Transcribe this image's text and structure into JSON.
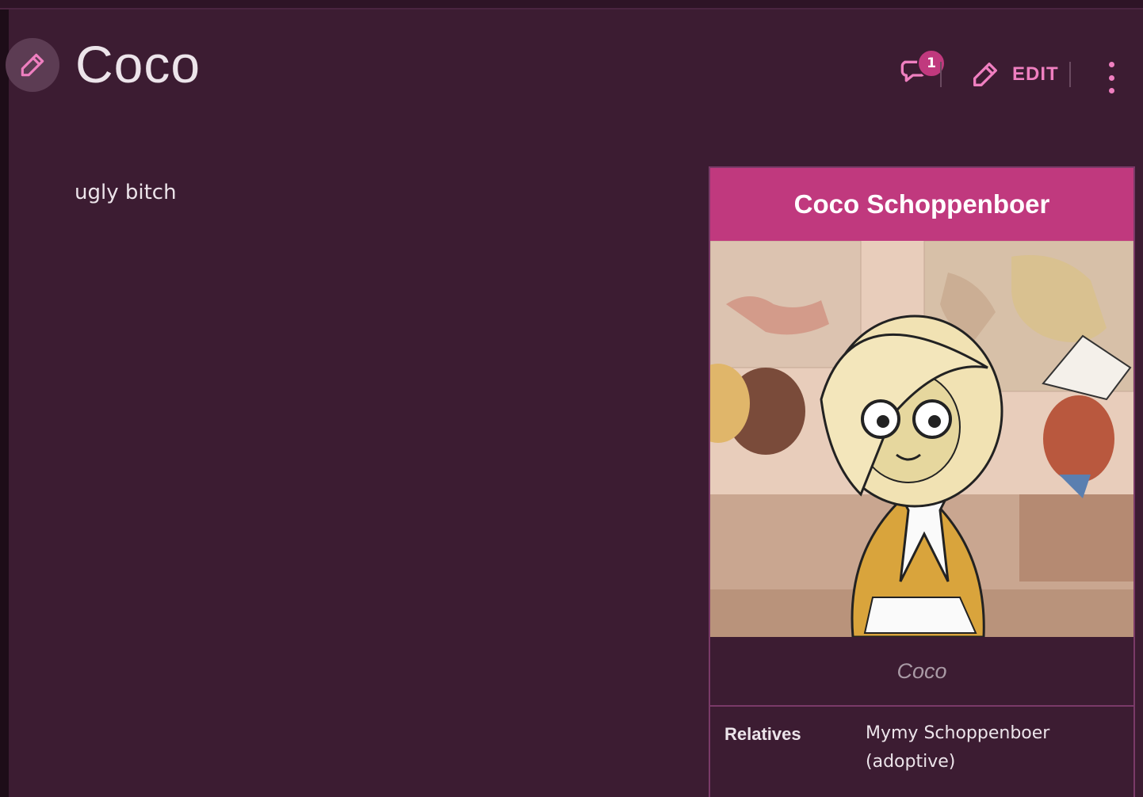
{
  "page": {
    "title": "Coco",
    "body_text": "ugly bitch"
  },
  "toolbar": {
    "comment_count": "1",
    "edit_label": "EDIT",
    "icons": [
      "pencil-icon",
      "comment-icon",
      "more-vertical-icon"
    ]
  },
  "infobox": {
    "title": "Coco Schoppenboer",
    "caption": "Coco",
    "rows": [
      {
        "label": "Relatives",
        "value": "Mymy Schoppenboer (adoptive)"
      }
    ]
  },
  "colors": {
    "background": "#3c1c32",
    "accent": "#c0397e",
    "accent_light": "#ef7fc0",
    "text": "#ece4ea",
    "caption": "#a99aa5"
  }
}
